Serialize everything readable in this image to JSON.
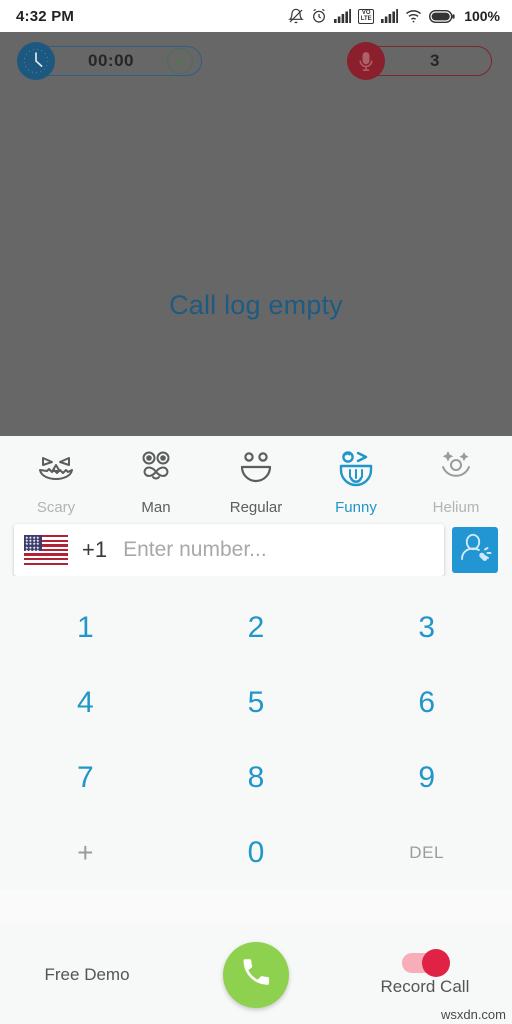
{
  "status_bar": {
    "time": "4:32 PM",
    "battery_text": "100%",
    "volte_top": "VO",
    "volte_bottom": "LTE",
    "icons": [
      "bell-muted-icon",
      "alarm-clock-icon",
      "signal-bars-icon",
      "volte-badge",
      "signal-bars-2-icon",
      "wifi-icon",
      "battery-icon"
    ]
  },
  "call_log": {
    "empty_message": "Call log empty",
    "timer_pill": {
      "icon": "clock-icon",
      "value": "00:00",
      "add_label": "+"
    },
    "recordings_pill": {
      "icon": "microphone-icon",
      "value": "3"
    },
    "overlay_color": "#676767"
  },
  "voice_effects": {
    "selected": "Funny",
    "items": [
      {
        "label": "Scary",
        "icon": "scary-face-icon",
        "state": "inactive"
      },
      {
        "label": "Man",
        "icon": "mustache-face-icon",
        "state": "normal"
      },
      {
        "label": "Regular",
        "icon": "smiley-face-icon",
        "state": "normal"
      },
      {
        "label": "Funny",
        "icon": "tongue-face-icon",
        "state": "selected"
      },
      {
        "label": "Helium",
        "icon": "sparkle-face-icon",
        "state": "inactive"
      }
    ]
  },
  "number_input": {
    "flag": "us-flag-icon",
    "country_code": "+1",
    "placeholder": "Enter number...",
    "value": "",
    "contacts_button_icon": "contact-call-icon"
  },
  "dialpad": {
    "rows": [
      [
        {
          "label": "1",
          "type": "digit"
        },
        {
          "label": "2",
          "type": "digit"
        },
        {
          "label": "3",
          "type": "digit"
        }
      ],
      [
        {
          "label": "4",
          "type": "digit"
        },
        {
          "label": "5",
          "type": "digit"
        },
        {
          "label": "6",
          "type": "digit"
        }
      ],
      [
        {
          "label": "7",
          "type": "digit"
        },
        {
          "label": "8",
          "type": "digit"
        },
        {
          "label": "9",
          "type": "digit"
        }
      ],
      [
        {
          "label": "+",
          "type": "symbol"
        },
        {
          "label": "0",
          "type": "digit"
        },
        {
          "label": "DEL",
          "type": "delete"
        }
      ]
    ]
  },
  "bottom_bar": {
    "demo_label": "Free Demo",
    "call_button_icon": "phone-handset-icon",
    "record_label": "Record Call",
    "record_enabled": true
  },
  "watermark": "wsxdn.com",
  "colors": {
    "accent_blue": "#2196c9",
    "call_green": "#8ed14f",
    "record_red": "#e02245",
    "overlay_gray": "#676767",
    "timer_blue": "#1c587f",
    "mic_red": "#8b1f2b"
  }
}
